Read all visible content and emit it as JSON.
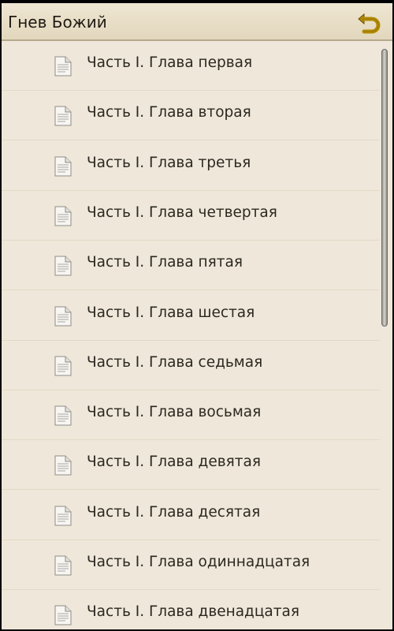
{
  "header": {
    "title": "Гнев Божий",
    "back_icon": "back-arrow-icon",
    "accent_color": "#b38a00"
  },
  "list": {
    "item_icon": "document-icon",
    "items": [
      {
        "label": "Часть I. Глава первая"
      },
      {
        "label": "Часть I. Глава вторая"
      },
      {
        "label": "Часть I. Глава третья"
      },
      {
        "label": "Часть I. Глава четвертая"
      },
      {
        "label": "Часть I. Глава пятая"
      },
      {
        "label": "Часть I. Глава шестая"
      },
      {
        "label": "Часть I. Глава седьмая"
      },
      {
        "label": "Часть I. Глава восьмая"
      },
      {
        "label": "Часть I. Глава девятая"
      },
      {
        "label": "Часть I. Глава десятая"
      },
      {
        "label": "Часть I. Глава одиннадцатая"
      },
      {
        "label": "Часть I. Глава двенадцатая"
      }
    ]
  },
  "colors": {
    "background": "#efe7da",
    "header_background": "#e6dcc5",
    "text": "#2b2820"
  }
}
